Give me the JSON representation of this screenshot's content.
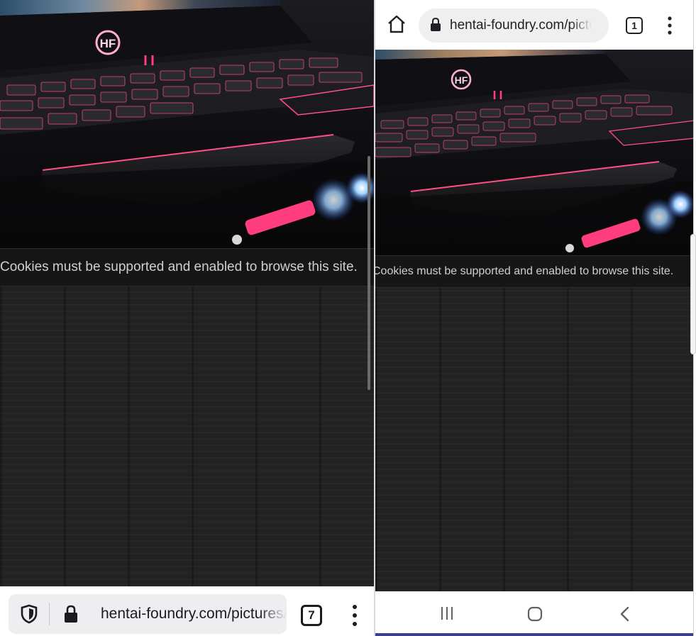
{
  "left_browser": {
    "cookie_message": "Cookies must be supported and enabled to browse this site.",
    "logo_text": "HF",
    "address_bar": {
      "url": "hentai-foundry.com/pictures/user/",
      "shield_icon": "shield-icon",
      "lock_icon": "lock-icon"
    },
    "tab_count": "7",
    "menu_icon": "vertical-dots-icon"
  },
  "right_browser": {
    "home_icon": "home-icon",
    "address_bar": {
      "url": "hentai-foundry.com/pictures/user/",
      "lock_icon": "lock-icon"
    },
    "tab_count": "1",
    "menu_icon": "vertical-dots-icon",
    "cookie_message": "Cookies must be supported and enabled to browse this site.",
    "logo_text": "HF"
  },
  "android_nav": {
    "recent_apps_icon": "recent-apps-icon",
    "home_icon": "circle-home-icon",
    "back_icon": "chevron-left-icon"
  },
  "colors": {
    "page_background": "#222222",
    "cookie_bar": "#161616",
    "cookie_text": "#cfcfcf",
    "accent_pink": "#ff3d7f",
    "nav_underline": "#3c3f8f"
  }
}
